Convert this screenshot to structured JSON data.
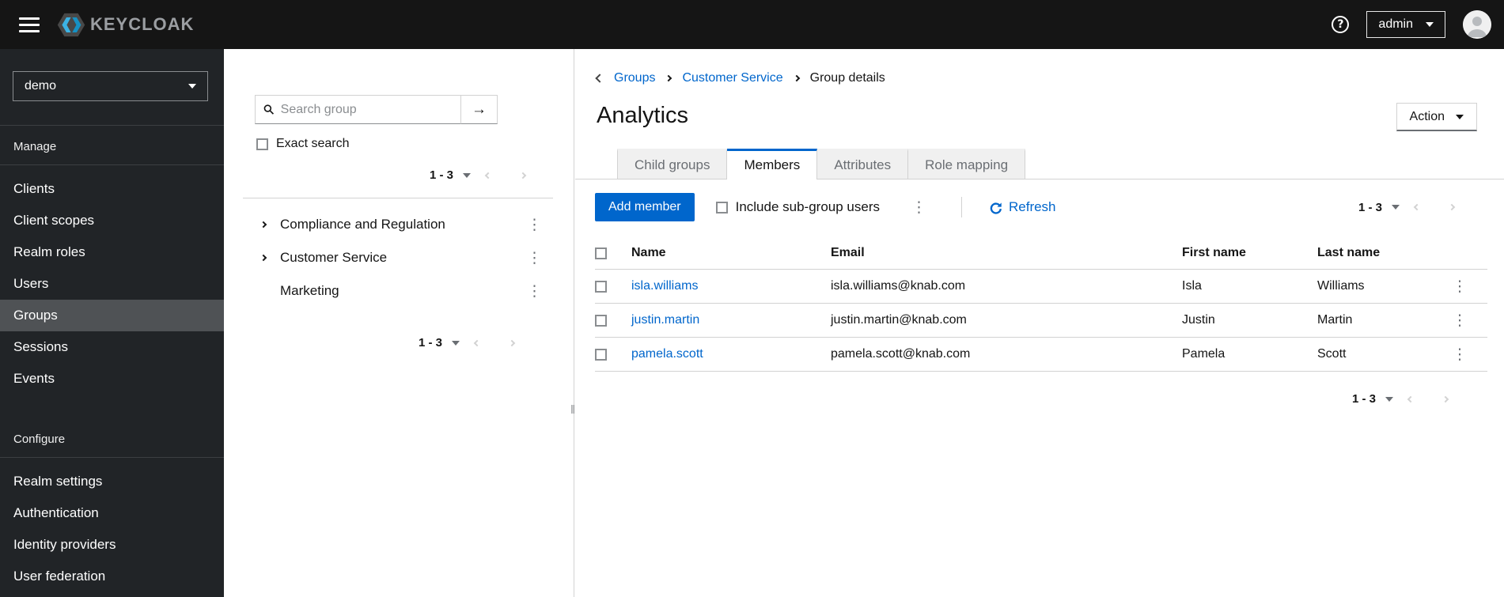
{
  "topbar": {
    "brand": "KEYCLOAK",
    "username": "admin"
  },
  "sidebar": {
    "realm": "demo",
    "manage_label": "Manage",
    "manage_items": [
      "Clients",
      "Client scopes",
      "Realm roles",
      "Users",
      "Groups",
      "Sessions",
      "Events"
    ],
    "active_item": "Groups",
    "configure_label": "Configure",
    "configure_items": [
      "Realm settings",
      "Authentication",
      "Identity providers",
      "User federation"
    ]
  },
  "groups_panel": {
    "search_placeholder": "Search group",
    "exact_search_label": "Exact search",
    "top_pagination": "1 - 3",
    "tree": [
      {
        "label": "Compliance and Regulation",
        "expandable": true
      },
      {
        "label": "Customer Service",
        "expandable": true
      },
      {
        "label": "Marketing",
        "expandable": false
      }
    ],
    "bottom_pagination": "1 - 3"
  },
  "main": {
    "breadcrumb": {
      "groups": "Groups",
      "parent": "Customer Service",
      "current": "Group details"
    },
    "title": "Analytics",
    "action_label": "Action",
    "tabs": [
      {
        "label": "Child groups",
        "active": false
      },
      {
        "label": "Members",
        "active": true
      },
      {
        "label": "Attributes",
        "active": false
      },
      {
        "label": "Role mapping",
        "active": false
      }
    ],
    "toolbar": {
      "add_member_label": "Add member",
      "include_subgroup_label": "Include sub-group users",
      "refresh_label": "Refresh",
      "pagination": "1 - 3"
    },
    "table": {
      "headers": {
        "name": "Name",
        "email": "Email",
        "first": "First name",
        "last": "Last name"
      },
      "rows": [
        {
          "name": "isla.williams",
          "email": "isla.williams@knab.com",
          "first": "Isla",
          "last": "Williams"
        },
        {
          "name": "justin.martin",
          "email": "justin.martin@knab.com",
          "first": "Justin",
          "last": "Martin"
        },
        {
          "name": "pamela.scott",
          "email": "pamela.scott@knab.com",
          "first": "Pamela",
          "last": "Scott"
        }
      ]
    },
    "bottom_pagination": "1 - 3"
  },
  "colors": {
    "accent": "#0066cc",
    "link": "#0066cc",
    "masthead_bg": "#151515",
    "sidebar_bg": "#212427",
    "sidebar_active_bg": "#4f5255",
    "tab_inactive_bg": "#f0f0f0",
    "border": "#d2d2d2",
    "muted_text": "#6a6e73"
  }
}
